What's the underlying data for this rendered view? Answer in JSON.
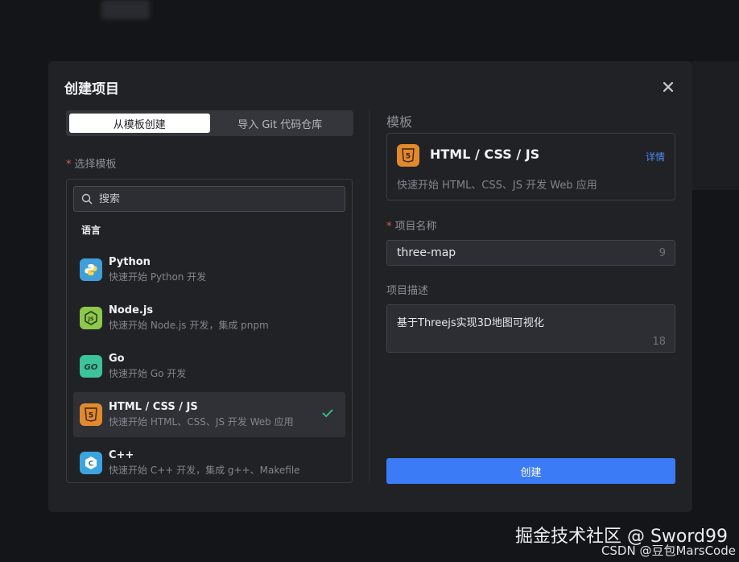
{
  "dialog": {
    "title": "创建项目",
    "close_icon": "close-icon"
  },
  "tabs": [
    {
      "label": "从模板创建",
      "active": true
    },
    {
      "label": "导入 Git 代码仓库",
      "active": false
    }
  ],
  "template_section": {
    "required_mark": "*",
    "label": "选择模板",
    "search_placeholder": "搜索",
    "group_label": "语言",
    "items": [
      {
        "name": "Python",
        "desc": "快速开始 Python 开发",
        "icon": "python-icon",
        "color": "#3f9fd8",
        "selected": false
      },
      {
        "name": "Node.js",
        "desc": "快速开始 Node.js 开发，集成 pnpm",
        "icon": "nodejs-icon",
        "color": "#8cc84b",
        "selected": false
      },
      {
        "name": "Go",
        "desc": "快速开始 Go 开发",
        "icon": "go-icon",
        "color": "#3cc39b",
        "selected": false
      },
      {
        "name": "HTML / CSS / JS",
        "desc": "快速开始 HTML、CSS、JS 开发 Web 应用",
        "icon": "html5-icon",
        "color": "#e1892d",
        "selected": true
      },
      {
        "name": "C++",
        "desc": "快速开始 C++ 开发，集成 g++、Makefile",
        "icon": "cpp-icon",
        "color": "#3ba4e0",
        "selected": false
      }
    ]
  },
  "right": {
    "section_title": "模板",
    "card": {
      "name": "HTML / CSS / JS",
      "link": "详情",
      "desc": "快速开始 HTML、CSS、JS 开发 Web 应用"
    },
    "name_field": {
      "required_mark": "*",
      "label": "项目名称",
      "value": "three-map",
      "count": "9"
    },
    "desc_field": {
      "label": "项目描述",
      "value": "基于Threejs实现3D地图可视化",
      "count": "18"
    },
    "submit_label": "创建"
  },
  "watermark": {
    "line1": "掘金技术社区 @ Sword99",
    "line2": "CSDN @豆包MarsCode"
  },
  "colors": {
    "accent": "#3b7cf6",
    "check": "#3cb37a",
    "required": "#e0584d"
  }
}
